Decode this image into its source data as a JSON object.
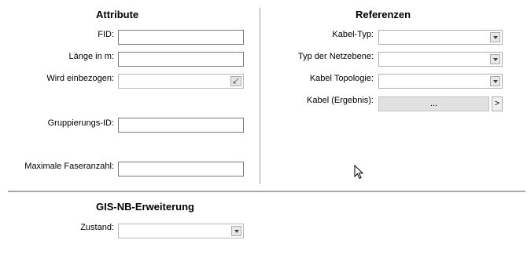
{
  "attribute": {
    "heading": "Attribute",
    "fid_label": "FID:",
    "laenge_label": "Länge in m:",
    "einbezogen_label": "Wird einbezogen:",
    "gruppierung_label": "Gruppierungs-ID:",
    "faseranzahl_label": "Maximale Faseranzahl:",
    "fid_value": "",
    "laenge_value": "",
    "gruppierung_value": "",
    "faseranzahl_value": ""
  },
  "referenzen": {
    "heading": "Referenzen",
    "kabeltyp_label": "Kabel-Typ:",
    "netzebene_label": "Typ der Netzebene:",
    "topologie_label": "Kabel Topologie:",
    "ergebnis_label": "Kabel (Ergebnis):",
    "ergebnis_button": "...",
    "ergebnis_arrow": ">"
  },
  "gis": {
    "heading": "GIS-NB-Erweiterung",
    "zustand_label": "Zustand:"
  },
  "icons": {
    "dropdown": "chevron-down-icon",
    "checkbox": "checkbox-icon",
    "cursor": "mouse-cursor-icon"
  }
}
